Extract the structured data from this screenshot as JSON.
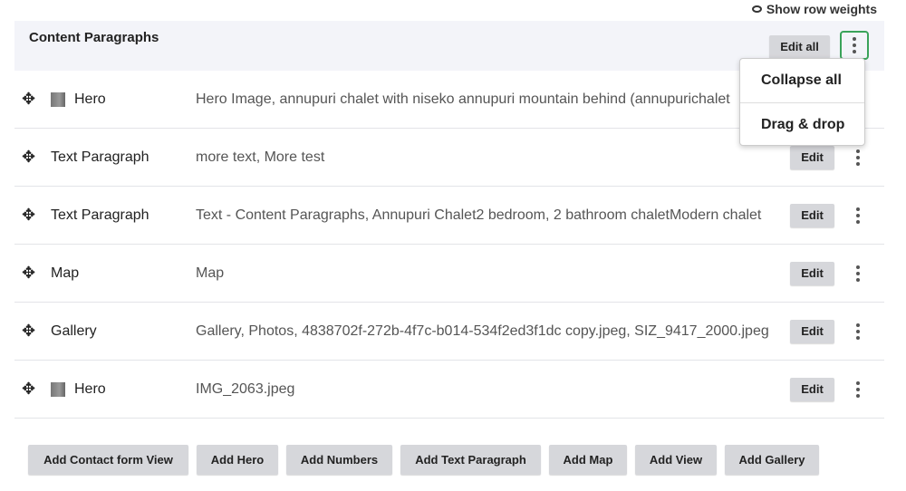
{
  "show_weights": "Show row weights",
  "header": {
    "title": "Content Paragraphs",
    "edit_all": "Edit all"
  },
  "menu": {
    "items": [
      "Collapse all",
      "Drag & drop"
    ]
  },
  "rows": [
    {
      "type": "Hero",
      "summary": "Hero Image, annupuri chalet with niseko annupuri mountain behind (annupurichalet",
      "thumb": true
    },
    {
      "type": "Text Paragraph",
      "summary": "more text, More test",
      "thumb": false
    },
    {
      "type": "Text Paragraph",
      "summary": "Text - Content Paragraphs, Annupuri Chalet2 bedroom, 2 bathroom chaletModern chalet",
      "thumb": false
    },
    {
      "type": "Map",
      "summary": "Map",
      "thumb": false
    },
    {
      "type": "Gallery",
      "summary": "Gallery, Photos, 4838702f-272b-4f7c-b014-534f2ed3f1dc copy.jpeg, SIZ_9417_2000.jpeg",
      "thumb": false
    },
    {
      "type": "Hero",
      "summary": "IMG_2063.jpeg",
      "thumb": true
    }
  ],
  "edit_label": "Edit",
  "add_buttons": [
    "Add Contact form View",
    "Add Hero",
    "Add Numbers",
    "Add Text Paragraph",
    "Add Map",
    "Add View",
    "Add Gallery"
  ],
  "colors": {
    "header_bg": "#f3f4f9",
    "focus": "#3aa35a",
    "button_bg": "#d6d7db"
  }
}
